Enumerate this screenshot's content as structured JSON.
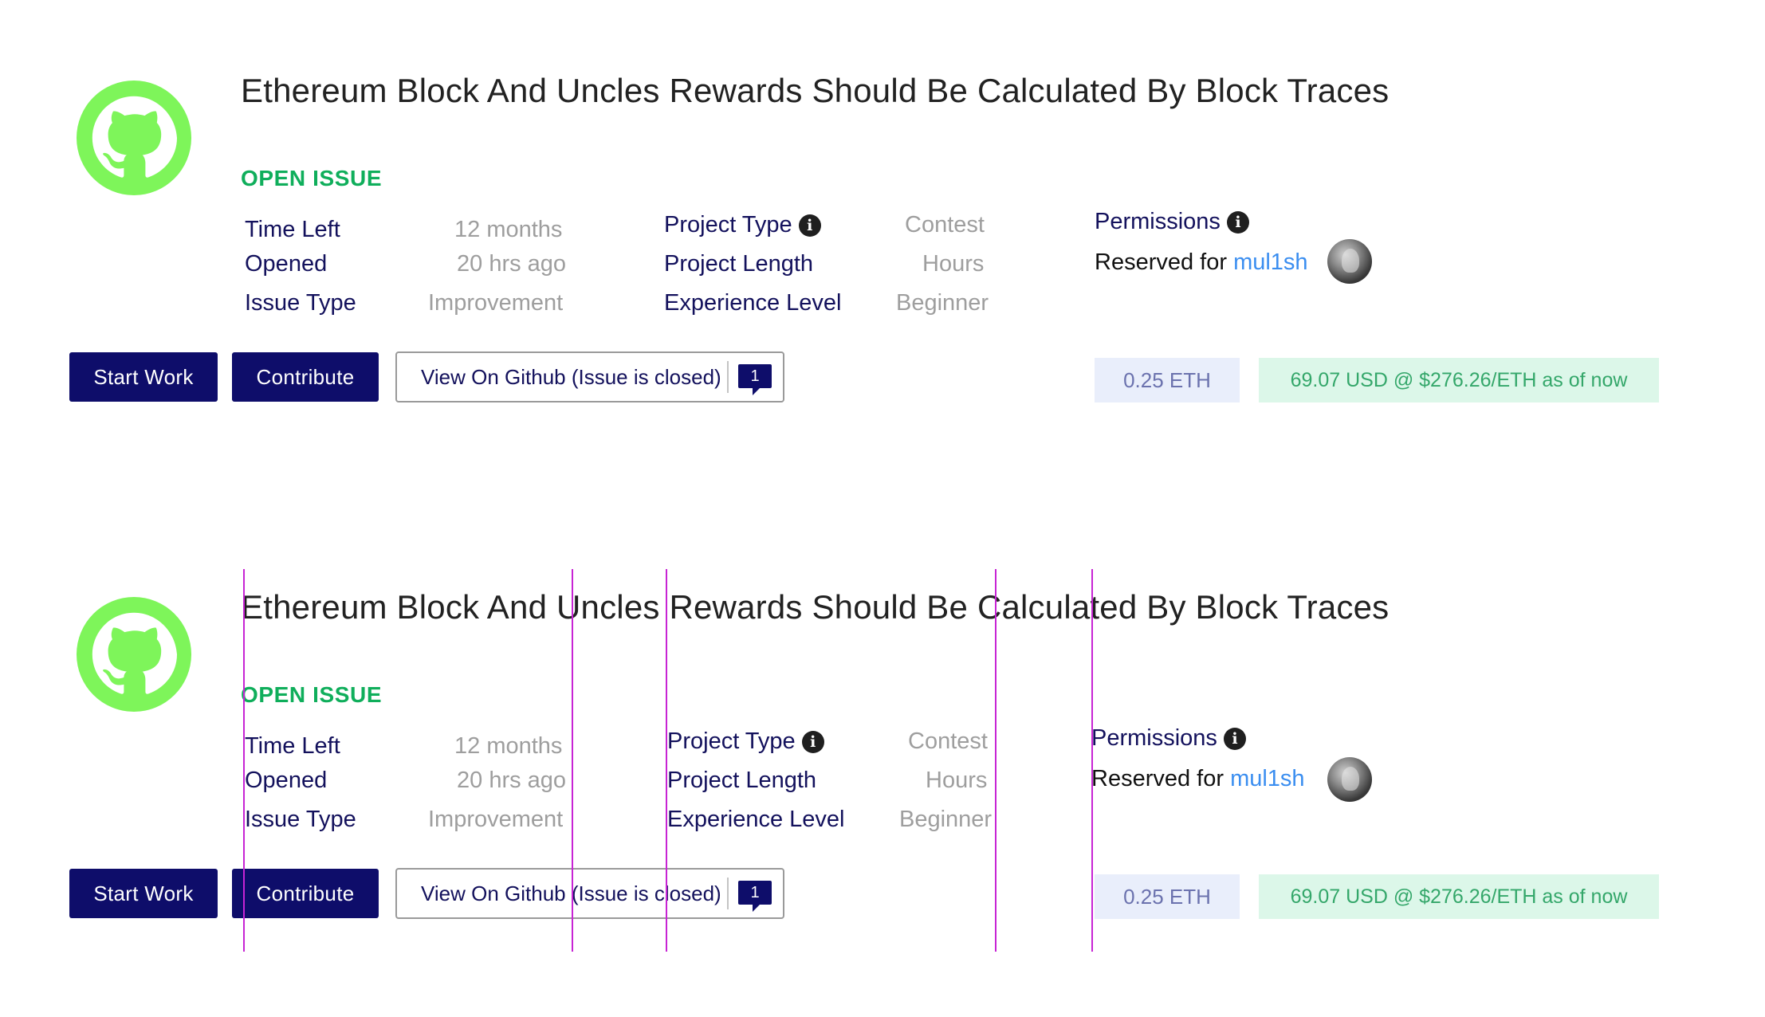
{
  "issue": {
    "title": "Ethereum Block And Uncles Rewards Should Be Calculated By Block Traces",
    "status": "OPEN ISSUE",
    "details": {
      "time_left_label": "Time Left",
      "time_left_value": "12 months",
      "opened_label": "Opened",
      "opened_value": "20 hrs ago",
      "issue_type_label": "Issue Type",
      "issue_type_value": "Improvement",
      "project_type_label": "Project Type",
      "project_type_value": "Contest",
      "project_length_label": "Project Length",
      "project_length_value": "Hours",
      "experience_level_label": "Experience Level",
      "experience_level_value": "Beginner"
    },
    "permissions": {
      "label": "Permissions",
      "reserved_prefix": "Reserved for",
      "reserved_user": "mul1sh"
    },
    "actions": {
      "start_work": "Start Work",
      "contribute": "Contribute",
      "view_github": "View On Github (Issue is closed)",
      "comment_count": "1"
    },
    "amount": {
      "eth": "0.25 ETH",
      "usd": "69.07  USD @  $276.26/ETH  as of now"
    }
  },
  "icons": {
    "logo": "github-icon",
    "info": "info-icon",
    "comment": "comment-bubble-icon"
  },
  "colors": {
    "brand_dark": "#0e0d6a",
    "status_green": "#0fae5b",
    "logo_green": "#7ef55a",
    "link_blue": "#3b8ef0",
    "guide_magenta": "#c724d4"
  }
}
